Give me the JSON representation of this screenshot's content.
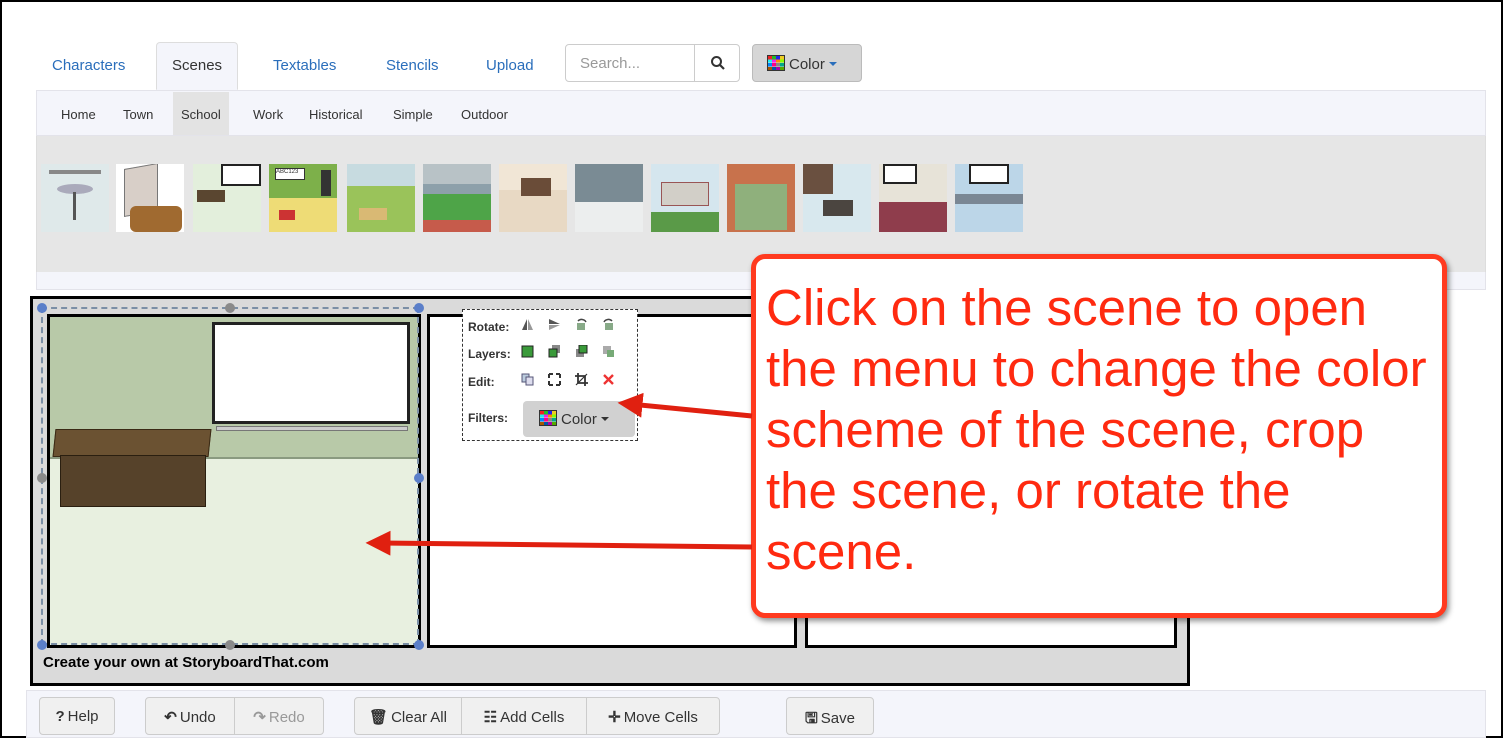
{
  "tabs": [
    "Characters",
    "Scenes",
    "Textables",
    "Stencils",
    "Upload"
  ],
  "active_tab": "Scenes",
  "search": {
    "placeholder": "Search..."
  },
  "color_button": "Color",
  "subtabs": [
    "Home",
    "Town",
    "School",
    "Work",
    "Historical",
    "Simple",
    "Outdoor"
  ],
  "active_subtab": "School",
  "thumbnails": [
    "cafeteria-table",
    "lockers",
    "classroom-desk",
    "kindergarten-room",
    "playground",
    "stadium",
    "gym-bleachers",
    "locker-hall",
    "school-building",
    "tennis-court",
    "library",
    "teacher-desk",
    "science-lab"
  ],
  "menu": {
    "rotate_label": "Rotate:",
    "layers_label": "Layers:",
    "edit_label": "Edit:",
    "filters_label": "Filters:",
    "filters_button": "Color"
  },
  "watermark": "Create your own at StoryboardThat.com",
  "callout": "Click on the scene to open the menu to change the color scheme of the scene, crop the scene, or rotate the scene.",
  "toolbar": {
    "help": "Help",
    "undo": "Undo",
    "redo": "Redo",
    "clear_all": "Clear All",
    "add_cells": "Add Cells",
    "move_cells": "Move Cells",
    "save": "Save"
  },
  "colors": {
    "accent": "#2a6ebb",
    "callout": "#ff3a1f"
  }
}
